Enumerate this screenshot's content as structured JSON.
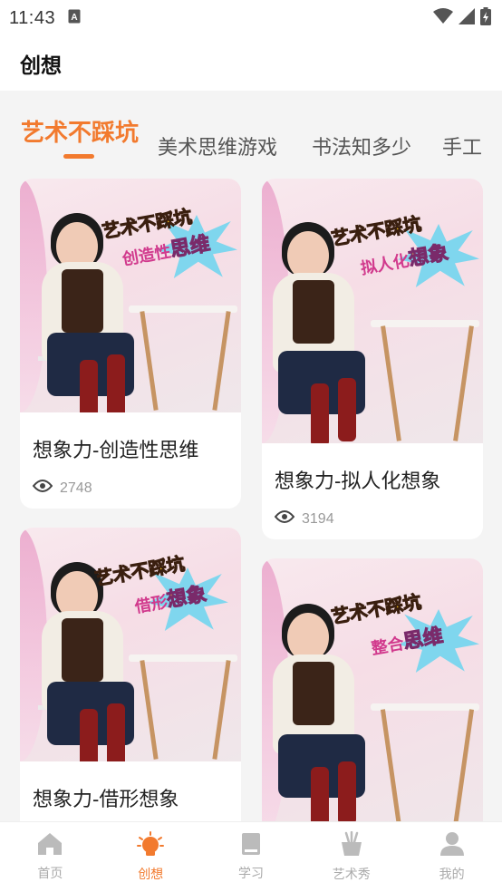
{
  "status_bar": {
    "time": "11:43"
  },
  "app_bar": {
    "title": "创想"
  },
  "tabs": [
    {
      "label": "艺术不踩坑",
      "active": true
    },
    {
      "label": "美术思维游戏",
      "active": false
    },
    {
      "label": "书法知多少",
      "active": false
    },
    {
      "label": "手工",
      "active": false
    }
  ],
  "cards": [
    {
      "title": "想象力-创造性思维",
      "views": "2748",
      "overlay_line1": "艺术不踩坑",
      "overlay_line2_prefix": "创造性",
      "overlay_line2_highlight": "思维"
    },
    {
      "title": "想象力-拟人化想象",
      "views": "3194",
      "overlay_line1": "艺术不踩坑",
      "overlay_line2_prefix": "拟人化",
      "overlay_line2_highlight": "想象"
    },
    {
      "title": "想象力-借形想象",
      "overlay_line1": "艺术不踩坑",
      "overlay_line2_prefix": "借形",
      "overlay_line2_highlight": "想象"
    },
    {
      "overlay_line1": "艺术不踩坑",
      "overlay_line2_prefix": "整合",
      "overlay_line2_highlight": "思维"
    }
  ],
  "bottom_nav": [
    {
      "label": "首页",
      "icon": "home-icon",
      "active": false
    },
    {
      "label": "创想",
      "icon": "lightbulb-icon",
      "active": true
    },
    {
      "label": "学习",
      "icon": "book-icon",
      "active": false
    },
    {
      "label": "艺术秀",
      "icon": "art-pot-icon",
      "active": false
    },
    {
      "label": "我的",
      "icon": "person-icon",
      "active": false
    }
  ],
  "colors": {
    "accent": "#f27a2e",
    "inactive": "#aaaaaa"
  }
}
